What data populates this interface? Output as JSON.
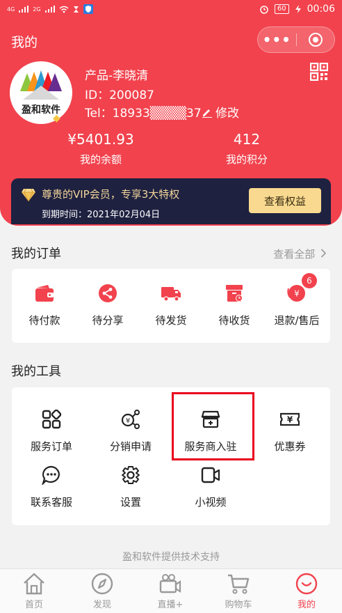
{
  "status_bar": {
    "left_icons": [
      "4G",
      "2G",
      "wifi",
      "hourglass",
      "shield"
    ],
    "battery": "60",
    "time": "00:06"
  },
  "header": {
    "title": "我的",
    "capsule_more": "•••",
    "avatar_label": "盈和软件"
  },
  "user": {
    "name": "产品-李晓清",
    "id": "ID：200087",
    "tel": "Tel：18933▒▒▒▒37",
    "edit_label": "修改"
  },
  "stats": {
    "balance_value": "¥5401.93",
    "balance_label": "我的余额",
    "points_value": "412",
    "points_label": "我的积分"
  },
  "vip": {
    "title": "尊贵的VIP会员，专享3大特权",
    "expire": "到期时间：2021年02月04日",
    "button_label": "查看权益"
  },
  "orders": {
    "title": "我的订单",
    "view_all": "查看全部",
    "items": [
      {
        "label": "待付款",
        "icon": "wallet-icon"
      },
      {
        "label": "待分享",
        "icon": "share-icon"
      },
      {
        "label": "待发货",
        "icon": "truck-icon"
      },
      {
        "label": "待收货",
        "icon": "box-icon"
      },
      {
        "label": "退款/售后",
        "icon": "refund-icon",
        "badge": "6"
      }
    ]
  },
  "tools": {
    "title": "我的工具",
    "items": [
      {
        "label": "服务订单",
        "icon": "grid-icon"
      },
      {
        "label": "分销申请",
        "icon": "distribution-icon"
      },
      {
        "label": "服务商入驻",
        "icon": "shop-icon"
      },
      {
        "label": "优惠券",
        "icon": "coupon-icon"
      },
      {
        "label": "联系客服",
        "icon": "chat-icon"
      },
      {
        "label": "设置",
        "icon": "settings-icon"
      },
      {
        "label": "小视频",
        "icon": "video-icon"
      }
    ]
  },
  "footer_note": "盈和软件提供技术支持",
  "tabbar": {
    "items": [
      {
        "label": "首页",
        "icon": "home-icon"
      },
      {
        "label": "发现",
        "icon": "compass-icon"
      },
      {
        "label": "直播+",
        "icon": "camera-icon"
      },
      {
        "label": "购物车",
        "icon": "cart-icon"
      },
      {
        "label": "我的",
        "icon": "smile-icon",
        "active": true
      }
    ]
  },
  "colors": {
    "brand_red": "#f1424d",
    "vip_dark": "#1e2140",
    "vip_gold": "#f8d98f",
    "highlight_red": "#e9001d"
  }
}
